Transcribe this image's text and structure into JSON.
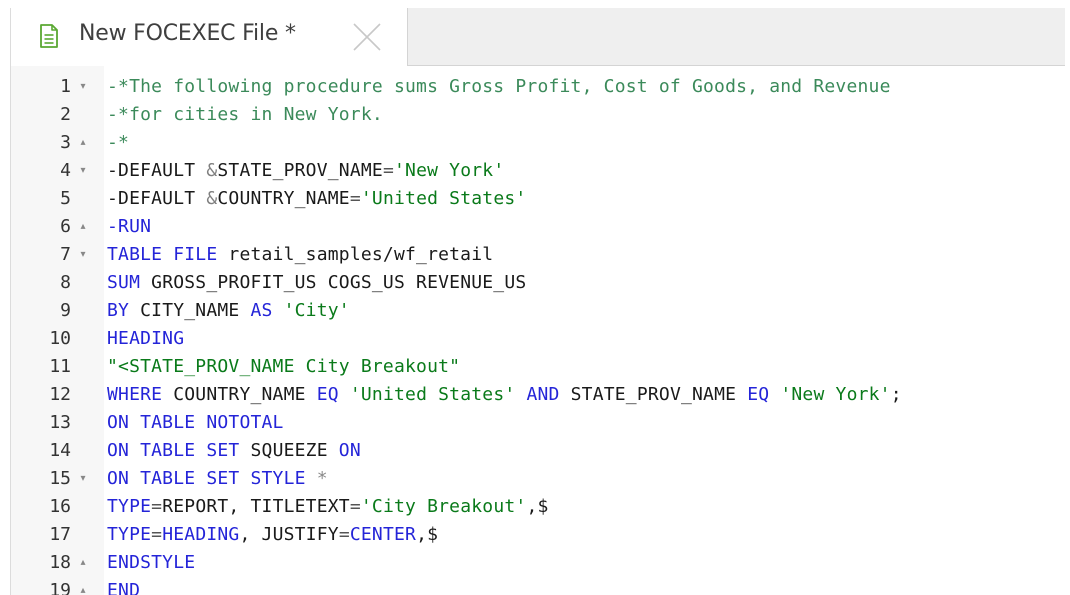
{
  "tab": {
    "title": "New FOCEXEC File *",
    "icon": "document-icon",
    "close_icon": "close-icon"
  },
  "colors": {
    "comment": "#3b8a5a",
    "keyword": "#2424d8",
    "string": "#0a7a1a",
    "plain": "#1a1a1a",
    "gutter_bg": "#f7f7f7",
    "tabbar_bg": "#efefef"
  },
  "editor": {
    "lines": [
      {
        "number": "1",
        "fold": "▾",
        "tokens": [
          {
            "type": "comment",
            "text": "-*The following procedure sums Gross Profit, Cost of Goods, and Revenue"
          }
        ]
      },
      {
        "number": "2",
        "fold": "",
        "tokens": [
          {
            "type": "comment",
            "text": "-*for cities in New York."
          }
        ]
      },
      {
        "number": "3",
        "fold": "▴",
        "tokens": [
          {
            "type": "comment",
            "text": "-*"
          }
        ]
      },
      {
        "number": "4",
        "fold": "▾",
        "tokens": [
          {
            "type": "plain",
            "text": "-DEFAULT "
          },
          {
            "type": "amp",
            "text": "&"
          },
          {
            "type": "plain",
            "text": "STATE_PROV_NAME"
          },
          {
            "type": "op",
            "text": "="
          },
          {
            "type": "string",
            "text": "'New York'"
          }
        ]
      },
      {
        "number": "5",
        "fold": "",
        "tokens": [
          {
            "type": "plain",
            "text": "-DEFAULT "
          },
          {
            "type": "amp",
            "text": "&"
          },
          {
            "type": "plain",
            "text": "COUNTRY_NAME"
          },
          {
            "type": "op",
            "text": "="
          },
          {
            "type": "string",
            "text": "'United States'"
          }
        ]
      },
      {
        "number": "6",
        "fold": "▴",
        "tokens": [
          {
            "type": "keyword",
            "text": "-RUN"
          }
        ]
      },
      {
        "number": "7",
        "fold": "▾",
        "tokens": [
          {
            "type": "keyword",
            "text": "TABLE FILE"
          },
          {
            "type": "plain",
            "text": " retail_samples/wf_retail"
          }
        ]
      },
      {
        "number": "8",
        "fold": "",
        "tokens": [
          {
            "type": "keyword",
            "text": "SUM"
          },
          {
            "type": "plain",
            "text": " GROSS_PROFIT_US COGS_US REVENUE_US"
          }
        ]
      },
      {
        "number": "9",
        "fold": "",
        "tokens": [
          {
            "type": "keyword",
            "text": "BY"
          },
          {
            "type": "plain",
            "text": " CITY_NAME "
          },
          {
            "type": "keyword",
            "text": "AS"
          },
          {
            "type": "plain",
            "text": " "
          },
          {
            "type": "string",
            "text": "'City'"
          }
        ]
      },
      {
        "number": "10",
        "fold": "",
        "tokens": [
          {
            "type": "keyword",
            "text": "HEADING"
          }
        ]
      },
      {
        "number": "11",
        "fold": "",
        "tokens": [
          {
            "type": "string",
            "text": "\"<STATE_PROV_NAME City Breakout\""
          }
        ]
      },
      {
        "number": "12",
        "fold": "",
        "tokens": [
          {
            "type": "keyword",
            "text": "WHERE"
          },
          {
            "type": "plain",
            "text": " COUNTRY_NAME "
          },
          {
            "type": "keyword",
            "text": "EQ"
          },
          {
            "type": "plain",
            "text": " "
          },
          {
            "type": "string",
            "text": "'United States'"
          },
          {
            "type": "plain",
            "text": " "
          },
          {
            "type": "keyword",
            "text": "AND"
          },
          {
            "type": "plain",
            "text": " STATE_PROV_NAME "
          },
          {
            "type": "keyword",
            "text": "EQ"
          },
          {
            "type": "plain",
            "text": " "
          },
          {
            "type": "string",
            "text": "'New York'"
          },
          {
            "type": "plain",
            "text": ";"
          }
        ]
      },
      {
        "number": "13",
        "fold": "",
        "tokens": [
          {
            "type": "keyword",
            "text": "ON TABLE NOTOTAL"
          }
        ]
      },
      {
        "number": "14",
        "fold": "",
        "tokens": [
          {
            "type": "keyword",
            "text": "ON TABLE SET"
          },
          {
            "type": "plain",
            "text": " SQUEEZE "
          },
          {
            "type": "keyword",
            "text": "ON"
          }
        ]
      },
      {
        "number": "15",
        "fold": "▾",
        "tokens": [
          {
            "type": "keyword",
            "text": "ON TABLE SET STYLE"
          },
          {
            "type": "plain",
            "text": " "
          },
          {
            "type": "star",
            "text": "*"
          }
        ]
      },
      {
        "number": "16",
        "fold": "",
        "tokens": [
          {
            "type": "keyword",
            "text": "TYPE"
          },
          {
            "type": "op",
            "text": "="
          },
          {
            "type": "plain",
            "text": "REPORT, TITLETEXT"
          },
          {
            "type": "op",
            "text": "="
          },
          {
            "type": "string",
            "text": "'City Breakout'"
          },
          {
            "type": "plain",
            "text": ",$"
          }
        ]
      },
      {
        "number": "17",
        "fold": "",
        "tokens": [
          {
            "type": "keyword",
            "text": "TYPE"
          },
          {
            "type": "op",
            "text": "="
          },
          {
            "type": "keyword",
            "text": "HEADING"
          },
          {
            "type": "plain",
            "text": ", JUSTIFY"
          },
          {
            "type": "op",
            "text": "="
          },
          {
            "type": "keyword",
            "text": "CENTER"
          },
          {
            "type": "plain",
            "text": ",$"
          }
        ]
      },
      {
        "number": "18",
        "fold": "▴",
        "tokens": [
          {
            "type": "keyword",
            "text": "ENDSTYLE"
          }
        ]
      },
      {
        "number": "19",
        "fold": "▴",
        "tokens": [
          {
            "type": "keyword",
            "text": "END"
          }
        ]
      }
    ]
  }
}
